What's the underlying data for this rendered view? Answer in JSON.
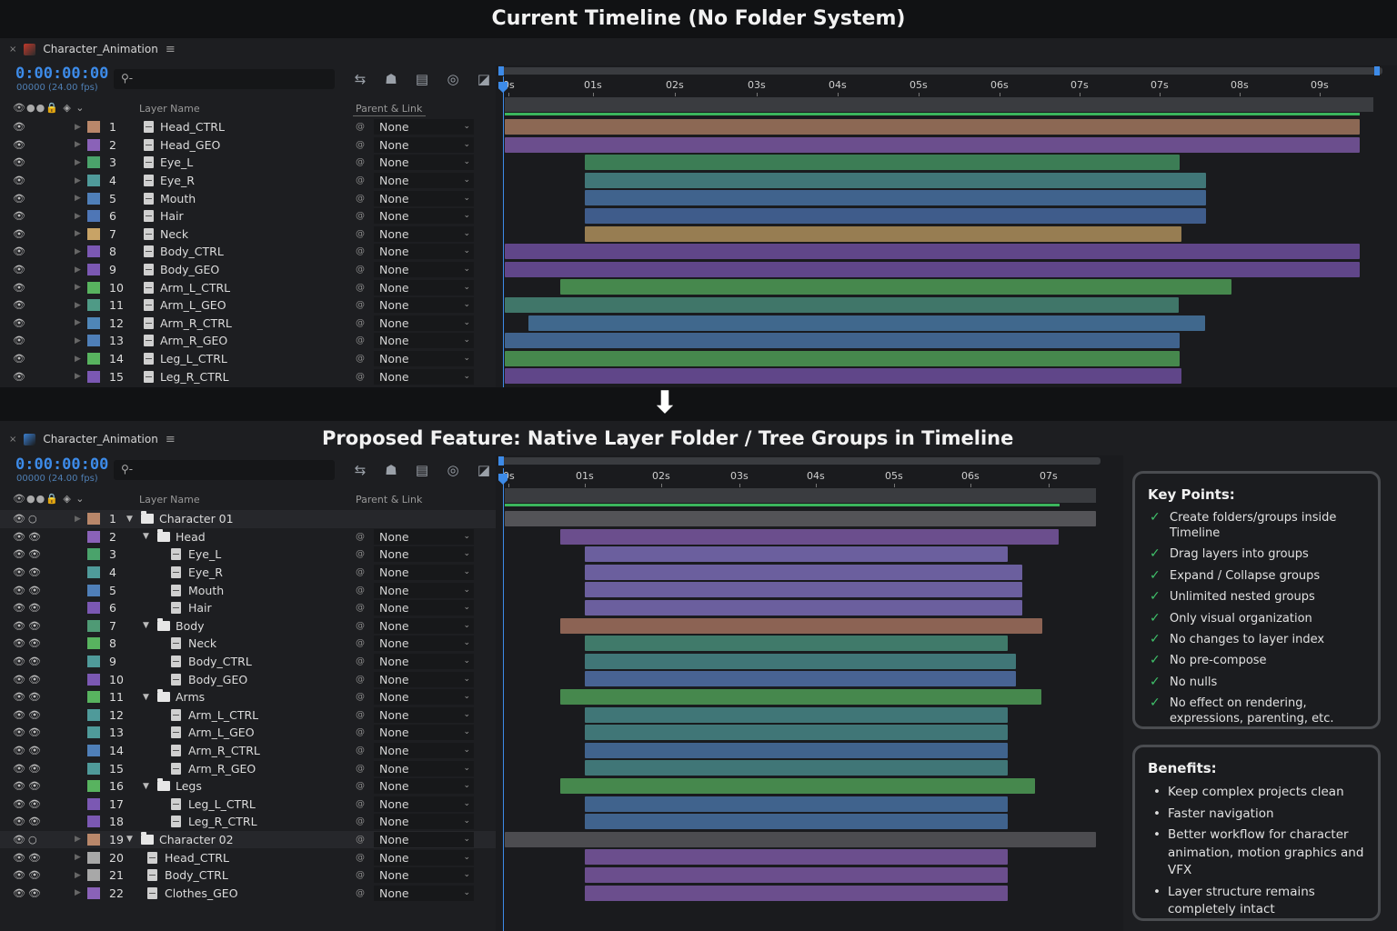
{
  "top_heading": "Current Timeline (No Folder System)",
  "bottom_heading": "Proposed Feature: Native Layer Folder / Tree Groups in Timeline",
  "comp_name": "Character_Animation",
  "timecode": "0:00:00:00",
  "fps_label": "00000 (24.00 fps)",
  "search_placeholder": "",
  "columns": {
    "layer_name": "Layer Name",
    "parent_link": "Parent & Link"
  },
  "parent_value": "None",
  "top_ruler": [
    "0s",
    "01s",
    "02s",
    "03s",
    "04s",
    "05s",
    "06s",
    "07s",
    "07s",
    "08s",
    "09s"
  ],
  "bottom_ruler": [
    "0s",
    "01s",
    "02s",
    "03s",
    "04s",
    "05s",
    "06s",
    "07s"
  ],
  "top_layers": [
    {
      "num": "1",
      "name": "Head_CTRL",
      "color": "#b9876a"
    },
    {
      "num": "2",
      "name": "Head_GEO",
      "color": "#8a62b8"
    },
    {
      "num": "3",
      "name": "Eye_L",
      "color": "#4aa36b"
    },
    {
      "num": "4",
      "name": "Eye_R",
      "color": "#4f9a9a"
    },
    {
      "num": "5",
      "name": "Mouth",
      "color": "#4f7fb8"
    },
    {
      "num": "6",
      "name": "Hair",
      "color": "#4e76b6"
    },
    {
      "num": "7",
      "name": "Neck",
      "color": "#c8a366"
    },
    {
      "num": "8",
      "name": "Body_CTRL",
      "color": "#7b58b3"
    },
    {
      "num": "9",
      "name": "Body_GEO",
      "color": "#7b58b3"
    },
    {
      "num": "10",
      "name": "Arm_L_CTRL",
      "color": "#58b35f"
    },
    {
      "num": "11",
      "name": "Arm_L_GEO",
      "color": "#4f9a86"
    },
    {
      "num": "12",
      "name": "Arm_R_CTRL",
      "color": "#4f86b8"
    },
    {
      "num": "13",
      "name": "Arm_R_GEO",
      "color": "#4f7fb8"
    },
    {
      "num": "14",
      "name": "Leg_L_CTRL",
      "color": "#58b35f"
    },
    {
      "num": "15",
      "name": "Leg_R_CTRL",
      "color": "#7b58b3"
    }
  ],
  "bottom_layers": [
    {
      "num": "1",
      "name": "Character 01",
      "color": "#b9876a",
      "type": "folder",
      "depth": 0
    },
    {
      "num": "2",
      "name": "Head",
      "color": "#8a62b8",
      "type": "folder",
      "depth": 1
    },
    {
      "num": "3",
      "name": "Eye_L",
      "color": "#4aa36b",
      "type": "layer",
      "depth": 2
    },
    {
      "num": "4",
      "name": "Eye_R",
      "color": "#4f9a9a",
      "type": "layer",
      "depth": 2
    },
    {
      "num": "5",
      "name": "Mouth",
      "color": "#4f7fb8",
      "type": "layer",
      "depth": 2
    },
    {
      "num": "6",
      "name": "Hair",
      "color": "#7b58b3",
      "type": "layer",
      "depth": 2
    },
    {
      "num": "7",
      "name": "Body",
      "color": "#4f9a75",
      "type": "folder",
      "depth": 1
    },
    {
      "num": "8",
      "name": "Neck",
      "color": "#58b35f",
      "type": "layer",
      "depth": 2
    },
    {
      "num": "9",
      "name": "Body_CTRL",
      "color": "#4f9a9a",
      "type": "layer",
      "depth": 2
    },
    {
      "num": "10",
      "name": "Body_GEO",
      "color": "#7b58b3",
      "type": "layer",
      "depth": 2
    },
    {
      "num": "11",
      "name": "Arms",
      "color": "#58b35f",
      "type": "folder",
      "depth": 1
    },
    {
      "num": "12",
      "name": "Arm_L_CTRL",
      "color": "#4f9a9a",
      "type": "layer",
      "depth": 2
    },
    {
      "num": "13",
      "name": "Arm_L_GEO",
      "color": "#4f9a9a",
      "type": "layer",
      "depth": 2
    },
    {
      "num": "14",
      "name": "Arm_R_CTRL",
      "color": "#4f7fb8",
      "type": "layer",
      "depth": 2
    },
    {
      "num": "15",
      "name": "Arm_R_GEO",
      "color": "#4f9a9a",
      "type": "layer",
      "depth": 2
    },
    {
      "num": "16",
      "name": "Legs",
      "color": "#58b35f",
      "type": "folder",
      "depth": 1
    },
    {
      "num": "17",
      "name": "Leg_L_CTRL",
      "color": "#7b58b3",
      "type": "layer",
      "depth": 2
    },
    {
      "num": "18",
      "name": "Leg_R_CTRL",
      "color": "#7b58b3",
      "type": "layer",
      "depth": 2
    },
    {
      "num": "19",
      "name": "Character 02",
      "color": "#b9876a",
      "type": "folder",
      "depth": 0
    },
    {
      "num": "20",
      "name": "Head_CTRL",
      "color": "#a8a8a8",
      "type": "layer",
      "depth": 1
    },
    {
      "num": "21",
      "name": "Body_CTRL",
      "color": "#a8a8a8",
      "type": "layer",
      "depth": 1
    },
    {
      "num": "22",
      "name": "Clothes_GEO",
      "color": "#8a62b8",
      "type": "layer",
      "depth": 1
    }
  ],
  "key_points": {
    "title": "Key Points:",
    "items": [
      "Create folders/groups inside Timeline",
      "Drag layers into groups",
      "Expand / Collapse groups",
      "Unlimited nested groups",
      "Only visual organization",
      "No changes to layer index",
      "No pre-compose",
      "No nulls",
      "No effect on rendering, expressions, parenting, etc."
    ]
  },
  "benefits": {
    "title": "Benefits:",
    "items": [
      "Keep complex projects clean",
      "Faster navigation",
      "Better workflow for character animation, motion graphics and VFX",
      "Layer structure remains completely intact"
    ]
  }
}
